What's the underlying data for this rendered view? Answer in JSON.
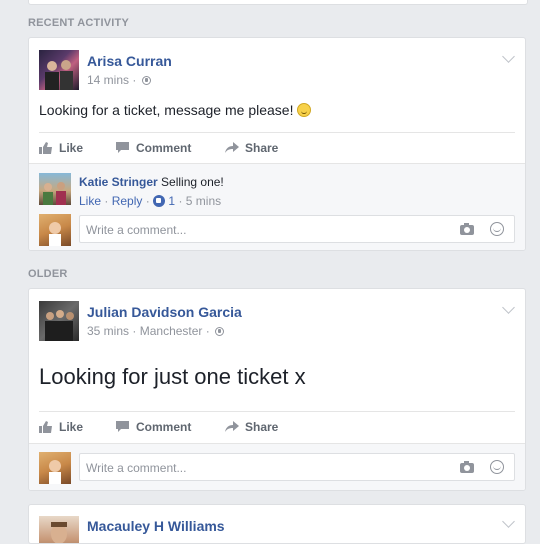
{
  "sections": {
    "recent": "RECENT ACTIVITY",
    "older": "OLDER"
  },
  "post1": {
    "author": "Arisa Curran",
    "time": "14 mins",
    "text": "Looking for a ticket, message me please!",
    "actions": {
      "like": "Like",
      "comment": "Comment",
      "share": "Share"
    },
    "reply": {
      "author": "Katie Stringer",
      "text": "Selling one!",
      "like": "Like",
      "reply": "Reply",
      "reactions": "1",
      "time": "5 mins"
    },
    "comment_placeholder": "Write a comment..."
  },
  "post2": {
    "author": "Julian Davidson Garcia",
    "time": "35 mins",
    "location": "Manchester",
    "text": "Looking for just one ticket x",
    "actions": {
      "like": "Like",
      "comment": "Comment",
      "share": "Share"
    },
    "comment_placeholder": "Write a comment..."
  },
  "post3": {
    "author": "Macauley H Williams"
  },
  "colors": {
    "link": "#365899",
    "meta": "#90949c",
    "bg": "#e9ebee"
  }
}
